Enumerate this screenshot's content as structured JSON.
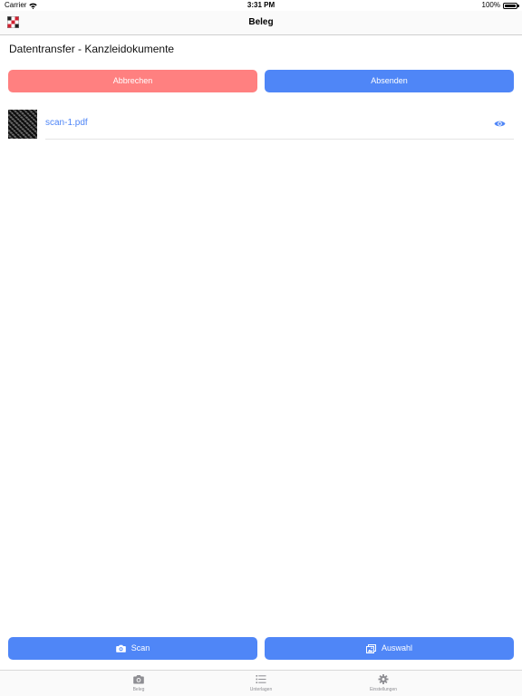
{
  "status_bar": {
    "carrier": "Carrier",
    "time": "3:31 PM",
    "battery": "100%"
  },
  "nav": {
    "title": "Beleg",
    "logo_icon": "app-logo-icon"
  },
  "page": {
    "title": "Datentransfer - Kanzleidokumente"
  },
  "actions": {
    "cancel_label": "Abbrechen",
    "send_label": "Absenden"
  },
  "files": [
    {
      "name": "scan-1.pdf",
      "action_icon": "eye-icon"
    }
  ],
  "bottom_actions": {
    "scan_label": "Scan",
    "select_label": "Auswahl"
  },
  "tabs": [
    {
      "label": "Beleg",
      "icon": "camera-icon"
    },
    {
      "label": "Unterlagen",
      "icon": "list-icon"
    },
    {
      "label": "Einstellungen",
      "icon": "gear-icon"
    }
  ],
  "colors": {
    "accent": "#4f86f7",
    "cancel": "#ff8080",
    "tab_inactive": "#8e8e93"
  }
}
